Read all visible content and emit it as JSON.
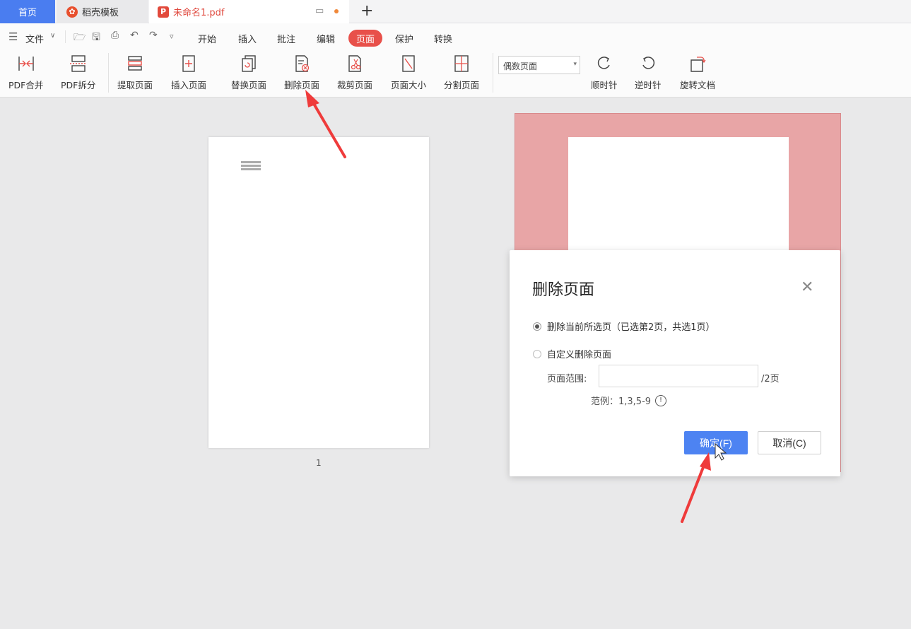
{
  "tabs": {
    "home": "首页",
    "templates": "稻壳模板",
    "document": "未命名1.pdf"
  },
  "menu": {
    "file": "文件",
    "items": [
      "开始",
      "插入",
      "批注",
      "编辑",
      "页面",
      "保护",
      "转换"
    ],
    "active": "页面"
  },
  "toolbar": {
    "pdf_merge": "PDF合并",
    "pdf_split": "PDF拆分",
    "extract": "提取页面",
    "insert": "插入页面",
    "replace": "替换页面",
    "delete": "删除页面",
    "crop": "裁剪页面",
    "page_size": "页面大小",
    "split_page": "分割页面",
    "page_select": "偶数页面",
    "clockwise": "顺时针",
    "counter": "逆时针",
    "rotate": "旋转文档"
  },
  "content": {
    "page1_number": "1"
  },
  "dialog": {
    "title": "删除页面",
    "option_current": "删除当前所选页（已选第2页，共选1页）",
    "option_custom": "自定义删除页面",
    "range_label": "页面范围:",
    "range_value": "",
    "range_suffix": "/2页",
    "example": "范例：1,3,5-9",
    "ok": "确定(F)",
    "cancel": "取消(C)"
  },
  "colors": {
    "accent": "#4d83f2",
    "active_tab": "#e8504a",
    "selection": "#e8a5a6",
    "annotation_arrow": "#ef3b3b"
  }
}
